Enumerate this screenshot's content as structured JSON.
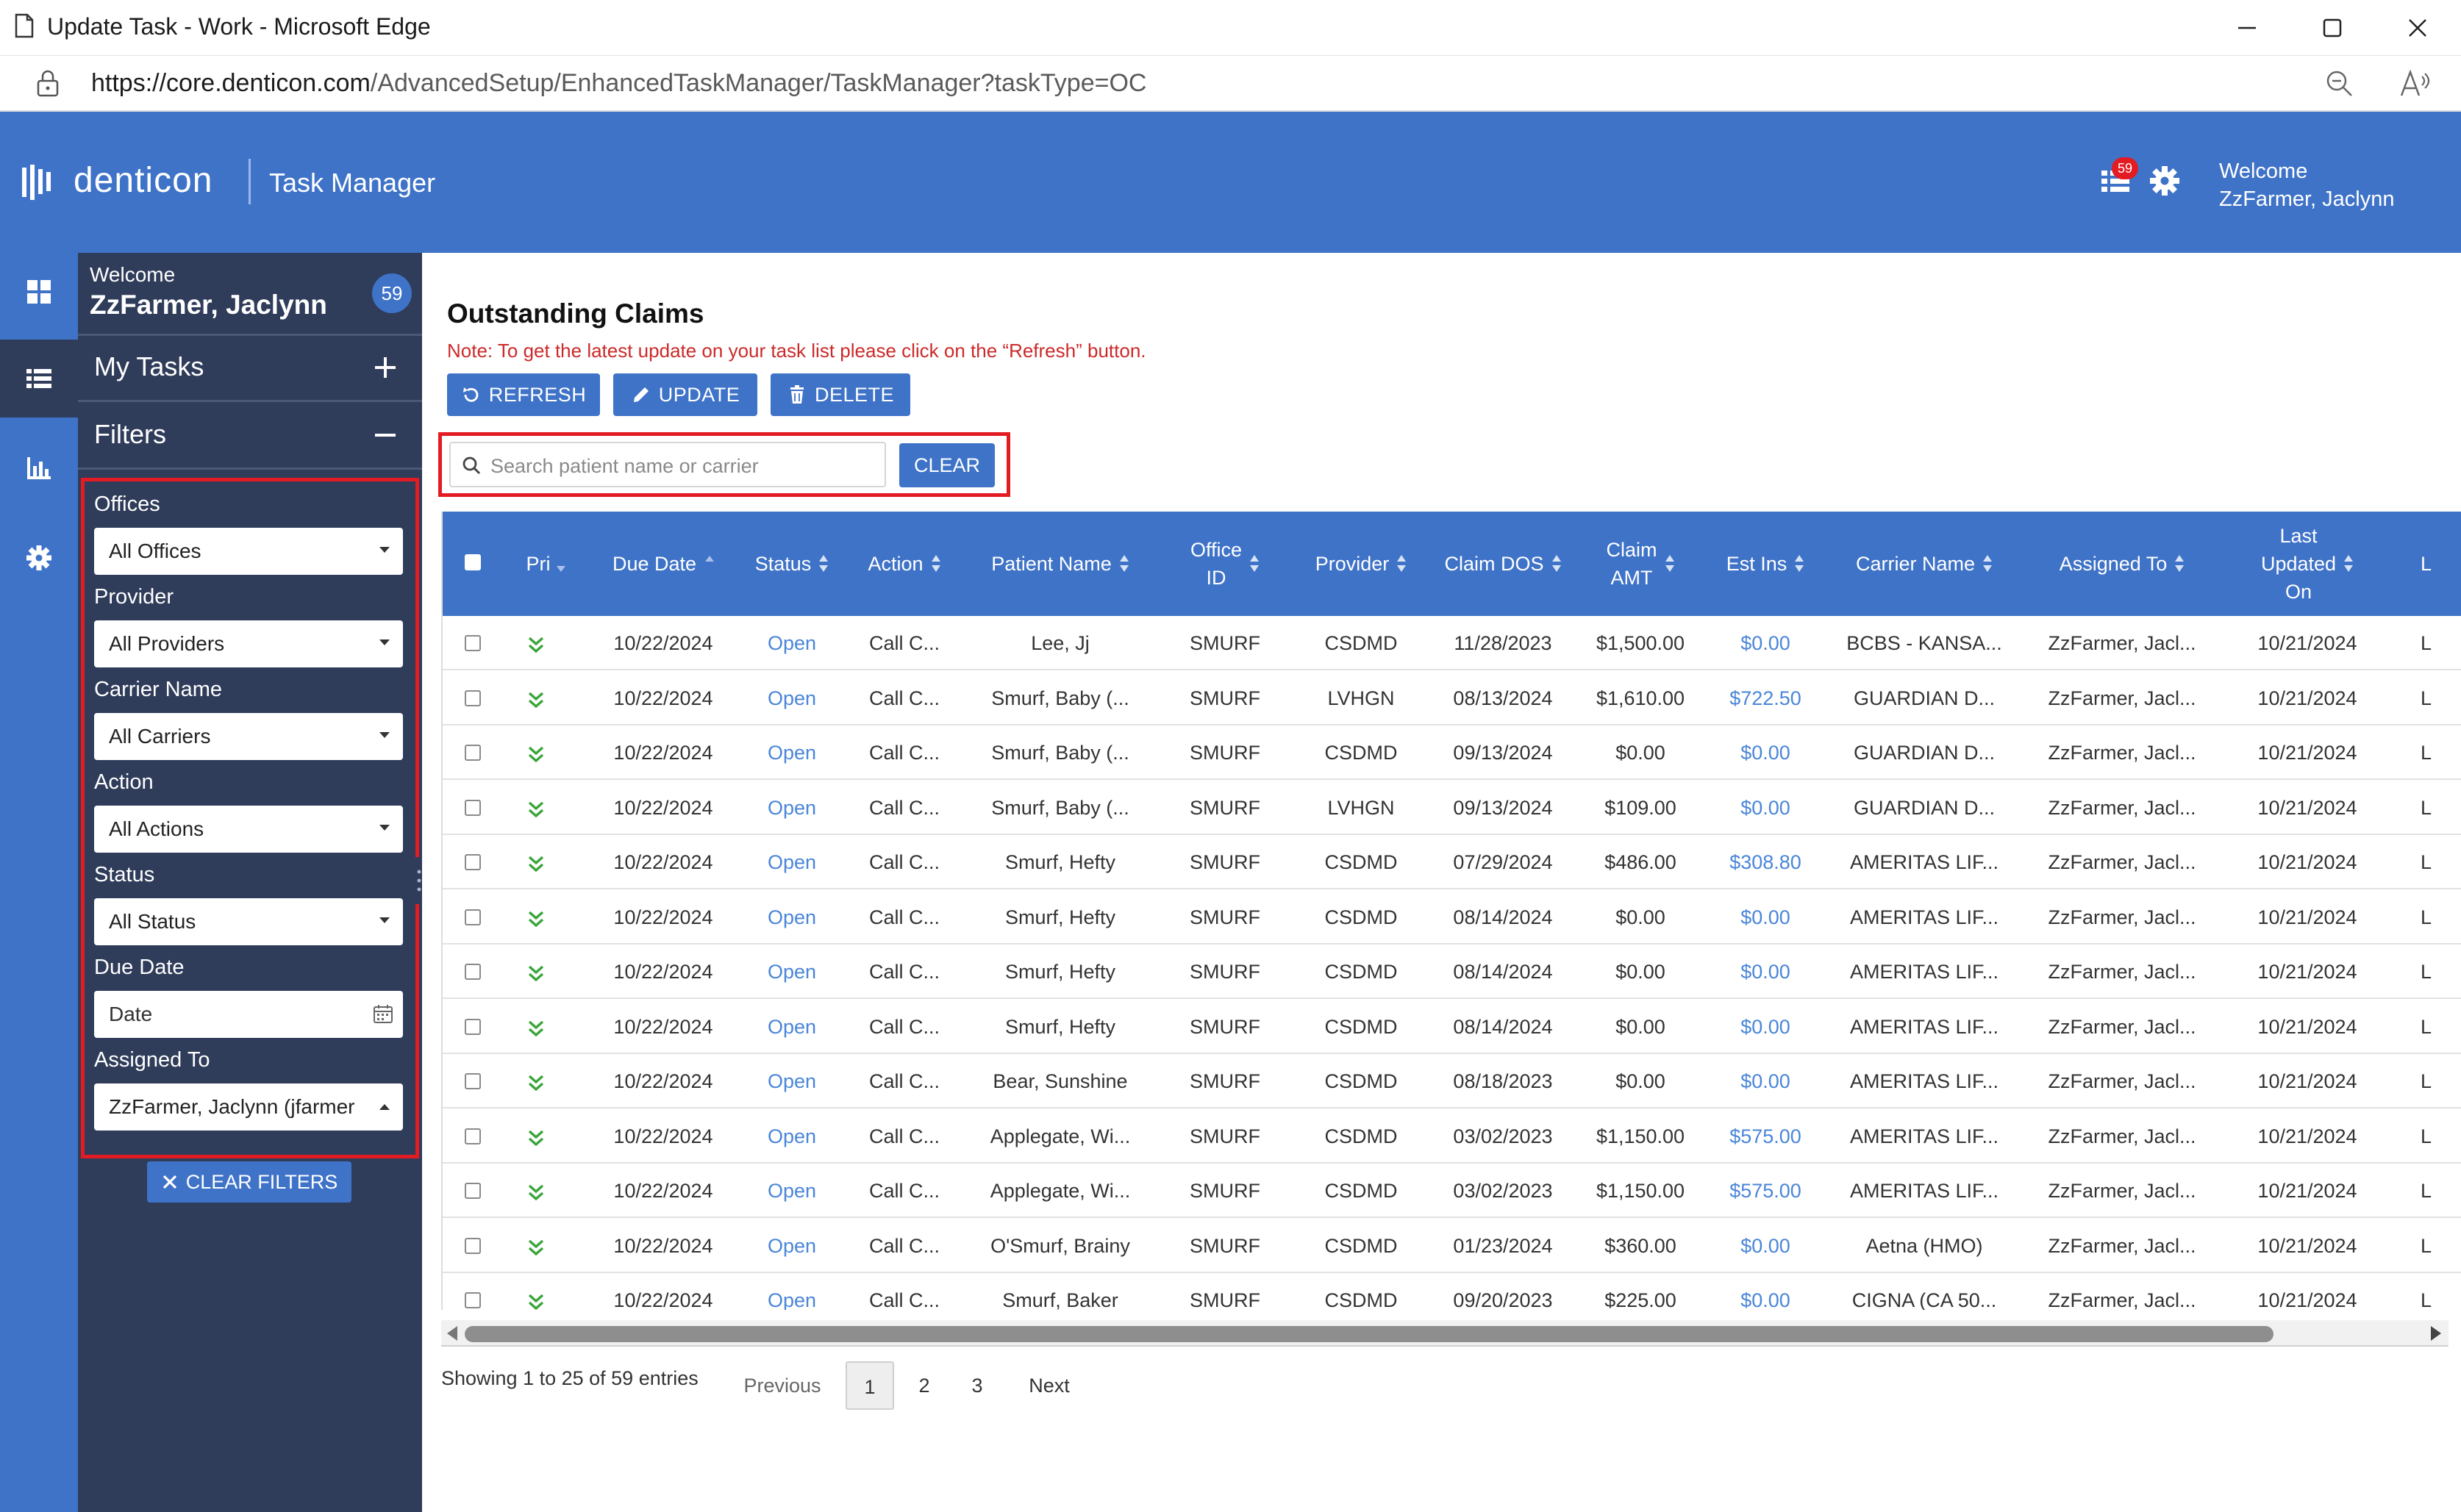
{
  "window": {
    "title": "Update Task - Work - Microsoft Edge",
    "url_host": "https://core.denticon.com",
    "url_path": "/AdvancedSetup/EnhancedTaskManager/TaskManager?taskType=OC"
  },
  "header": {
    "logo": "denticon",
    "app_title": "Task Manager",
    "task_badge": "59",
    "welcome_line1": "Welcome",
    "welcome_line2": "ZzFarmer, Jaclynn"
  },
  "sidebar": {
    "welcome": "Welcome",
    "user": "ZzFarmer, Jaclynn",
    "count": "59",
    "my_tasks": "My Tasks",
    "filters": "Filters",
    "fields": [
      {
        "label": "Offices",
        "value": "All Offices"
      },
      {
        "label": "Provider",
        "value": "All Providers"
      },
      {
        "label": "Carrier Name",
        "value": "All Carriers"
      },
      {
        "label": "Action",
        "value": "All Actions"
      },
      {
        "label": "Status",
        "value": "All Status"
      },
      {
        "label": "Due Date",
        "value": "Date"
      },
      {
        "label": "Assigned To",
        "value": "ZzFarmer, Jaclynn (jfarmer"
      }
    ],
    "clear_filters": "CLEAR FILTERS"
  },
  "main": {
    "title": "Outstanding Claims",
    "note": "Note: To get the latest update on your task list please click on the “Refresh” button.",
    "buttons": {
      "refresh": "REFRESH",
      "update": "UPDATE",
      "delete": "DELETE"
    },
    "search_placeholder": "Search patient name or carrier",
    "clear": "CLEAR"
  },
  "table": {
    "columns": {
      "pri": "Pri",
      "due_date": "Due Date",
      "status": "Status",
      "action": "Action",
      "patient": "Patient Name",
      "office_1": "Office",
      "office_2": "ID",
      "provider": "Provider",
      "claim_dos": "Claim DOS",
      "claim_amt_1": "Claim",
      "claim_amt_2": "AMT",
      "est_ins": "Est Ins",
      "carrier": "Carrier Name",
      "assigned": "Assigned To",
      "updated_1": "Last",
      "updated_2": "Updated",
      "updated_3": "On",
      "next_col": "L"
    },
    "rows": [
      {
        "due": "10/22/2024",
        "status": "Open",
        "action": "Call C...",
        "patient": "Lee, Jj",
        "office": "SMURF",
        "provider": "CSDMD",
        "dos": "11/28/2023",
        "amt": "$1,500.00",
        "est": "$0.00",
        "carrier": "BCBS - KANSA...",
        "assigned": "ZzFarmer, Jacl...",
        "updated": "10/21/2024",
        "more": "L"
      },
      {
        "due": "10/22/2024",
        "status": "Open",
        "action": "Call C...",
        "patient": "Smurf, Baby (...",
        "office": "SMURF",
        "provider": "LVHGN",
        "dos": "08/13/2024",
        "amt": "$1,610.00",
        "est": "$722.50",
        "carrier": "GUARDIAN D...",
        "assigned": "ZzFarmer, Jacl...",
        "updated": "10/21/2024",
        "more": "L"
      },
      {
        "due": "10/22/2024",
        "status": "Open",
        "action": "Call C...",
        "patient": "Smurf, Baby (...",
        "office": "SMURF",
        "provider": "CSDMD",
        "dos": "09/13/2024",
        "amt": "$0.00",
        "est": "$0.00",
        "carrier": "GUARDIAN D...",
        "assigned": "ZzFarmer, Jacl...",
        "updated": "10/21/2024",
        "more": "L"
      },
      {
        "due": "10/22/2024",
        "status": "Open",
        "action": "Call C...",
        "patient": "Smurf, Baby (...",
        "office": "SMURF",
        "provider": "LVHGN",
        "dos": "09/13/2024",
        "amt": "$109.00",
        "est": "$0.00",
        "carrier": "GUARDIAN D...",
        "assigned": "ZzFarmer, Jacl...",
        "updated": "10/21/2024",
        "more": "L"
      },
      {
        "due": "10/22/2024",
        "status": "Open",
        "action": "Call C...",
        "patient": "Smurf, Hefty",
        "office": "SMURF",
        "provider": "CSDMD",
        "dos": "07/29/2024",
        "amt": "$486.00",
        "est": "$308.80",
        "carrier": "AMERITAS LIF...",
        "assigned": "ZzFarmer, Jacl...",
        "updated": "10/21/2024",
        "more": "L"
      },
      {
        "due": "10/22/2024",
        "status": "Open",
        "action": "Call C...",
        "patient": "Smurf, Hefty",
        "office": "SMURF",
        "provider": "CSDMD",
        "dos": "08/14/2024",
        "amt": "$0.00",
        "est": "$0.00",
        "carrier": "AMERITAS LIF...",
        "assigned": "ZzFarmer, Jacl...",
        "updated": "10/21/2024",
        "more": "L"
      },
      {
        "due": "10/22/2024",
        "status": "Open",
        "action": "Call C...",
        "patient": "Smurf, Hefty",
        "office": "SMURF",
        "provider": "CSDMD",
        "dos": "08/14/2024",
        "amt": "$0.00",
        "est": "$0.00",
        "carrier": "AMERITAS LIF...",
        "assigned": "ZzFarmer, Jacl...",
        "updated": "10/21/2024",
        "more": "L"
      },
      {
        "due": "10/22/2024",
        "status": "Open",
        "action": "Call C...",
        "patient": "Smurf, Hefty",
        "office": "SMURF",
        "provider": "CSDMD",
        "dos": "08/14/2024",
        "amt": "$0.00",
        "est": "$0.00",
        "carrier": "AMERITAS LIF...",
        "assigned": "ZzFarmer, Jacl...",
        "updated": "10/21/2024",
        "more": "L"
      },
      {
        "due": "10/22/2024",
        "status": "Open",
        "action": "Call C...",
        "patient": "Bear, Sunshine",
        "office": "SMURF",
        "provider": "CSDMD",
        "dos": "08/18/2023",
        "amt": "$0.00",
        "est": "$0.00",
        "carrier": "AMERITAS LIF...",
        "assigned": "ZzFarmer, Jacl...",
        "updated": "10/21/2024",
        "more": "L"
      },
      {
        "due": "10/22/2024",
        "status": "Open",
        "action": "Call C...",
        "patient": "Applegate, Wi...",
        "office": "SMURF",
        "provider": "CSDMD",
        "dos": "03/02/2023",
        "amt": "$1,150.00",
        "est": "$575.00",
        "carrier": "AMERITAS LIF...",
        "assigned": "ZzFarmer, Jacl...",
        "updated": "10/21/2024",
        "more": "L"
      },
      {
        "due": "10/22/2024",
        "status": "Open",
        "action": "Call C...",
        "patient": "Applegate, Wi...",
        "office": "SMURF",
        "provider": "CSDMD",
        "dos": "03/02/2023",
        "amt": "$1,150.00",
        "est": "$575.00",
        "carrier": "AMERITAS LIF...",
        "assigned": "ZzFarmer, Jacl...",
        "updated": "10/21/2024",
        "more": "L"
      },
      {
        "due": "10/22/2024",
        "status": "Open",
        "action": "Call C...",
        "patient": "O'Smurf, Brainy",
        "office": "SMURF",
        "provider": "CSDMD",
        "dos": "01/23/2024",
        "amt": "$360.00",
        "est": "$0.00",
        "carrier": "Aetna (HMO)",
        "assigned": "ZzFarmer, Jacl...",
        "updated": "10/21/2024",
        "more": "L"
      },
      {
        "due": "10/22/2024",
        "status": "Open",
        "action": "Call C...",
        "patient": "Smurf, Baker",
        "office": "SMURF",
        "provider": "CSDMD",
        "dos": "09/20/2023",
        "amt": "$225.00",
        "est": "$0.00",
        "carrier": "CIGNA (CA 50...",
        "assigned": "ZzFarmer, Jacl...",
        "updated": "10/21/2024",
        "more": "L"
      }
    ]
  },
  "footer": {
    "info": "Showing 1 to 25 of 59 entries",
    "previous": "Previous",
    "pages": [
      "1",
      "2",
      "3"
    ],
    "next": "Next"
  },
  "colors": {
    "brand_blue": "#3f73c8",
    "sidebar_navy": "#2f3c5a",
    "highlight_red": "#e31b23",
    "link_blue": "#4a86d8",
    "priority_green": "#3aa53a"
  },
  "icons": [
    "document-icon",
    "minimize-icon",
    "maximize-icon",
    "close-icon",
    "lock-icon",
    "zoom-out-icon",
    "read-aloud-icon",
    "task-list-icon",
    "gear-icon",
    "dashboard-icon",
    "list-icon",
    "chart-icon",
    "plus-icon",
    "minus-icon",
    "refresh-icon",
    "pencil-icon",
    "trash-icon",
    "search-icon",
    "calendar-icon",
    "priority-low-icon"
  ]
}
